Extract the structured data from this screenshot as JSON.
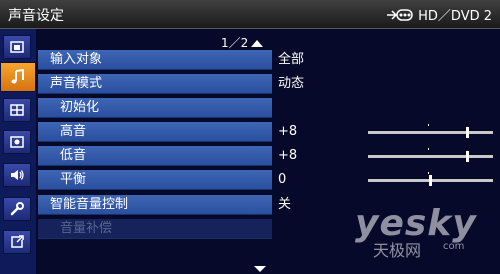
{
  "header": {
    "title": "声音设定",
    "source": "HD／DVD 2"
  },
  "sidebar": {
    "items": [
      {
        "name": "picture-icon"
      },
      {
        "name": "music-note-icon",
        "active": true
      },
      {
        "name": "grid-icon"
      },
      {
        "name": "display-icon"
      },
      {
        "name": "speaker-icon"
      },
      {
        "name": "wrench-icon"
      },
      {
        "name": "exit-icon"
      }
    ]
  },
  "menu": {
    "page_indicator": "1／2",
    "rows": [
      {
        "label": "输入对象",
        "value": "全部"
      },
      {
        "label": "声音模式",
        "value": "动态"
      },
      {
        "label": "初始化",
        "value": ""
      },
      {
        "label": "高音",
        "value": "+8",
        "slider": 0.8
      },
      {
        "label": "低音",
        "value": "+8",
        "slider": 0.8
      },
      {
        "label": "平衡",
        "value": "0",
        "slider": 0.5
      },
      {
        "label": "智能音量控制",
        "value": "关"
      },
      {
        "label": "音量补偿",
        "value": "",
        "disabled": true
      }
    ]
  },
  "watermark": {
    "brand": "yesky",
    "subtitle": "天极网",
    "url": "com"
  },
  "colors": {
    "accent": "#f39a22",
    "row": "#3a5fb0",
    "background": "#06092a"
  }
}
